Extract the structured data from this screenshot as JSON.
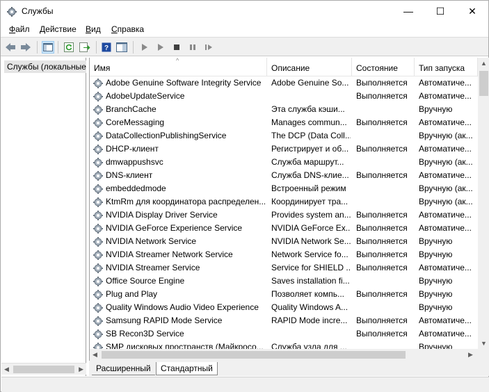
{
  "window": {
    "title": "Службы",
    "minimize": "—",
    "maximize": "☐",
    "close": "✕"
  },
  "menu": [
    {
      "label": "Файл",
      "accel": "Ф",
      "rest": "айл"
    },
    {
      "label": "Действие",
      "accel": "Д",
      "rest": "ействие"
    },
    {
      "label": "Вид",
      "accel": "В",
      "rest": "ид"
    },
    {
      "label": "Справка",
      "accel": "С",
      "rest": "правка"
    }
  ],
  "toolbar": {
    "icons": [
      "back-icon",
      "forward-icon",
      "show-hide-tree-icon",
      "refresh-icon",
      "export-list-icon",
      "help-icon",
      "properties-pane-icon",
      "start-service-icon",
      "start-service-alt-icon",
      "stop-service-icon",
      "pause-service-icon",
      "restart-service-icon"
    ]
  },
  "tree": {
    "root_label": "Службы (локальные)"
  },
  "columns": {
    "name": "Имя",
    "desc": "Описание",
    "status": "Состояние",
    "startup": "Тип запуска"
  },
  "services": [
    {
      "name": "Adobe Genuine Software Integrity Service",
      "desc": "Adobe Genuine So...",
      "status": "Выполняется",
      "startup": "Автоматиче..."
    },
    {
      "name": "AdobeUpdateService",
      "desc": "",
      "status": "Выполняется",
      "startup": "Автоматиче..."
    },
    {
      "name": "BranchCache",
      "desc": "Эта служба кэши...",
      "status": "",
      "startup": "Вручную"
    },
    {
      "name": "CoreMessaging",
      "desc": "Manages commun...",
      "status": "Выполняется",
      "startup": "Автоматиче..."
    },
    {
      "name": "DataCollectionPublishingService",
      "desc": "The DCP (Data Coll...",
      "status": "",
      "startup": "Вручную (ак..."
    },
    {
      "name": "DHCP-клиент",
      "desc": "Регистрирует и об...",
      "status": "Выполняется",
      "startup": "Автоматиче..."
    },
    {
      "name": "dmwappushsvc",
      "desc": "Служба маршрут...",
      "status": "",
      "startup": "Вручную (ак..."
    },
    {
      "name": "DNS-клиент",
      "desc": "Служба DNS-клие...",
      "status": "Выполняется",
      "startup": "Автоматиче..."
    },
    {
      "name": "embeddedmode",
      "desc": "Встроенный режим",
      "status": "",
      "startup": "Вручную (ак..."
    },
    {
      "name": "KtmRm для координатора распределен...",
      "desc": "Координирует тра...",
      "status": "",
      "startup": "Вручную (ак..."
    },
    {
      "name": "NVIDIA Display Driver Service",
      "desc": "Provides system an...",
      "status": "Выполняется",
      "startup": "Автоматиче..."
    },
    {
      "name": "NVIDIA GeForce Experience Service",
      "desc": "NVIDIA GeForce Ex...",
      "status": "Выполняется",
      "startup": "Автоматиче..."
    },
    {
      "name": "NVIDIA Network Service",
      "desc": "NVIDIA Network Se...",
      "status": "Выполняется",
      "startup": "Вручную"
    },
    {
      "name": "NVIDIA Streamer Network Service",
      "desc": "Network Service fo...",
      "status": "Выполняется",
      "startup": "Вручную"
    },
    {
      "name": "NVIDIA Streamer Service",
      "desc": "Service for SHIELD ...",
      "status": "Выполняется",
      "startup": "Автоматиче..."
    },
    {
      "name": "Office  Source Engine",
      "desc": "Saves installation fi...",
      "status": "",
      "startup": "Вручную"
    },
    {
      "name": "Plug and Play",
      "desc": "Позволяет компь...",
      "status": "Выполняется",
      "startup": "Вручную"
    },
    {
      "name": "Quality Windows Audio Video Experience",
      "desc": "Quality Windows A...",
      "status": "",
      "startup": "Вручную"
    },
    {
      "name": "Samsung RAPID Mode Service",
      "desc": "RAPID Mode incre...",
      "status": "Выполняется",
      "startup": "Автоматиче..."
    },
    {
      "name": "SB Recon3D Service",
      "desc": "",
      "status": "Выполняется",
      "startup": "Автоматиче..."
    },
    {
      "name": "SMP дисковых пространств (Майкросо...",
      "desc": "Служба узла для ...",
      "status": "",
      "startup": "Вручную"
    }
  ],
  "tabs": {
    "extended": "Расширенный",
    "standard": "Стандартный"
  }
}
